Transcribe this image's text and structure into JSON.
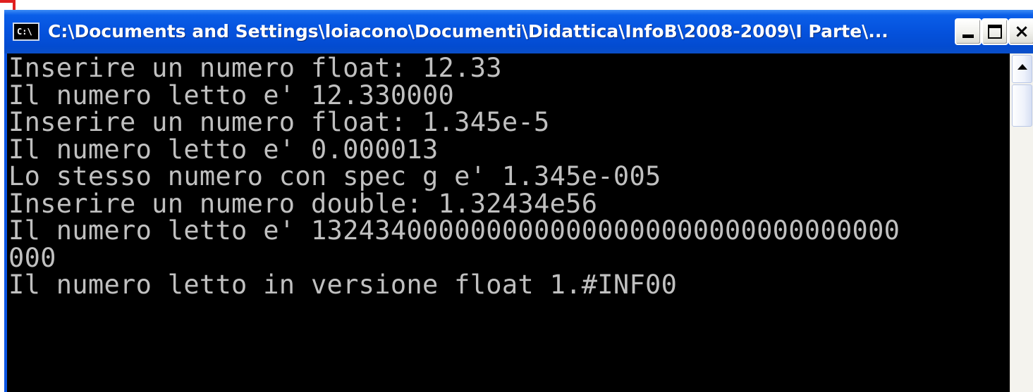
{
  "window": {
    "title": "C:\\Documents and Settings\\loiacono\\Documenti\\Didattica\\InfoB\\2008-2009\\I Parte\\...",
    "icon_name": "console-window-icon",
    "icon_text": "C:\\",
    "buttons": {
      "minimize": "minimize-icon",
      "maximize": "maximize-icon",
      "close": "close-icon",
      "close_glyph": "×"
    }
  },
  "console": {
    "lines": [
      "Inserire un numero float: 12.33",
      "Il numero letto e' 12.330000",
      "Inserire un numero float: 1.345e-5",
      "Il numero letto e' 0.000013",
      "Lo stesso numero con spec g e' 1.345e-005",
      "Inserire un numero double: 1.32434e56",
      "Il numero letto e' 1324340000000000000000000000000000000",
      "000",
      "Il numero letto in versione float 1.#INF00"
    ]
  },
  "scrollbar": {
    "up_arrow": "scroll-up-arrow-icon"
  },
  "colors": {
    "titlebar": "#0552dd",
    "console_background": "#000000",
    "console_text": "#c0c0c0",
    "corner_mark": "#e02020"
  }
}
